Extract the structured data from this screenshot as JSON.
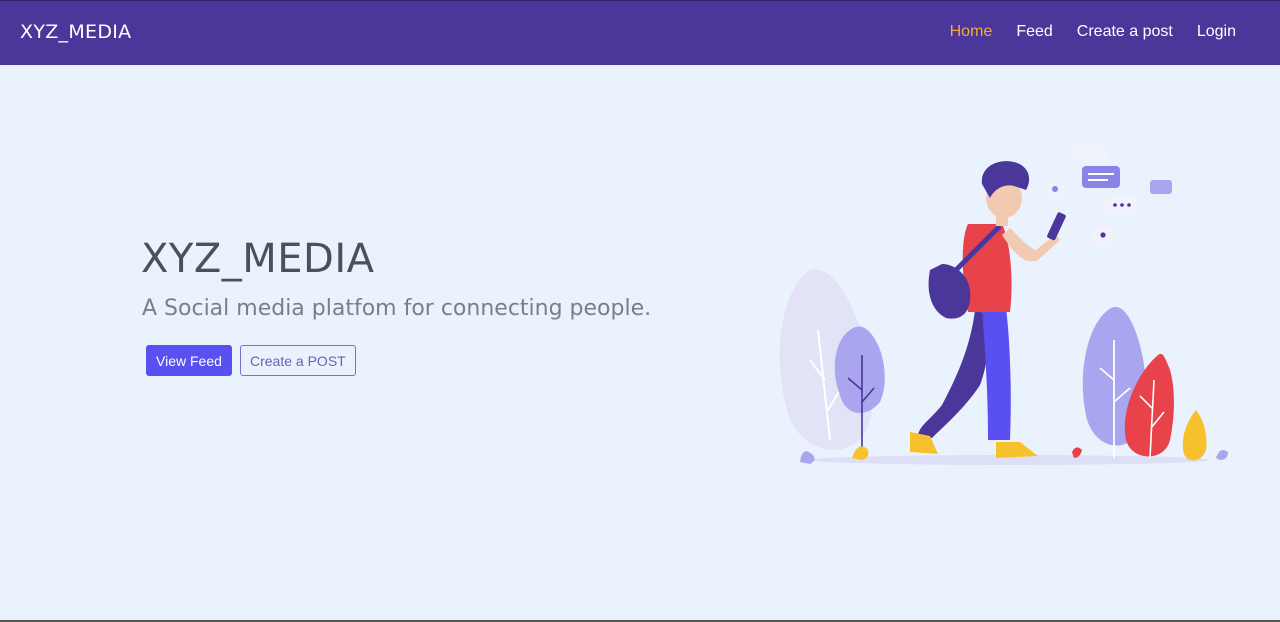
{
  "navbar": {
    "brand": "XYZ_MEDIA",
    "links": [
      {
        "label": "Home",
        "active": true
      },
      {
        "label": "Feed",
        "active": false
      },
      {
        "label": "Create a post",
        "active": false
      },
      {
        "label": "Login",
        "active": false
      }
    ]
  },
  "hero": {
    "title": "XYZ_MEDIA",
    "subtitle": "A Social media platfom for connecting people.",
    "primary_button": "View Feed",
    "secondary_button": "Create a POST"
  },
  "colors": {
    "navbar_bg": "#4a3799",
    "active_link": "#f4a93c",
    "page_bg": "#eaf3fd",
    "primary_button": "#5a4ff0"
  },
  "icons": {
    "illustration": "person-walking-with-phone-illustration"
  }
}
